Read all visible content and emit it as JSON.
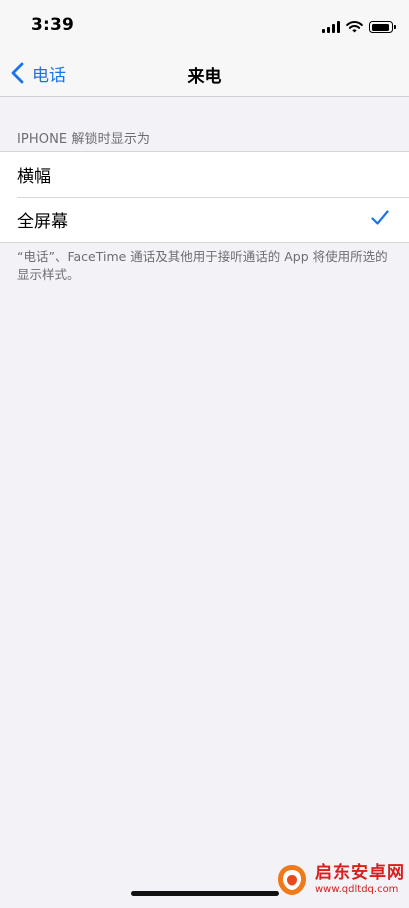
{
  "status_bar": {
    "time": "3:39"
  },
  "nav": {
    "back_label": "电话",
    "title": "来电"
  },
  "section": {
    "header": "IPHONE 解锁时显示为"
  },
  "options": [
    {
      "label": "横幅",
      "selected": false
    },
    {
      "label": "全屏幕",
      "selected": true
    }
  ],
  "footer": {
    "note": "“电话”、FaceTime 通话及其他用于接听通话的 App 将使用所选的显示样式。"
  },
  "watermark": {
    "title": "启东安卓网",
    "url": "www.qdltdq.com"
  },
  "colors": {
    "accent": "#1a73e8",
    "background": "#f2f2f7",
    "watermark": "#d81e1e"
  }
}
